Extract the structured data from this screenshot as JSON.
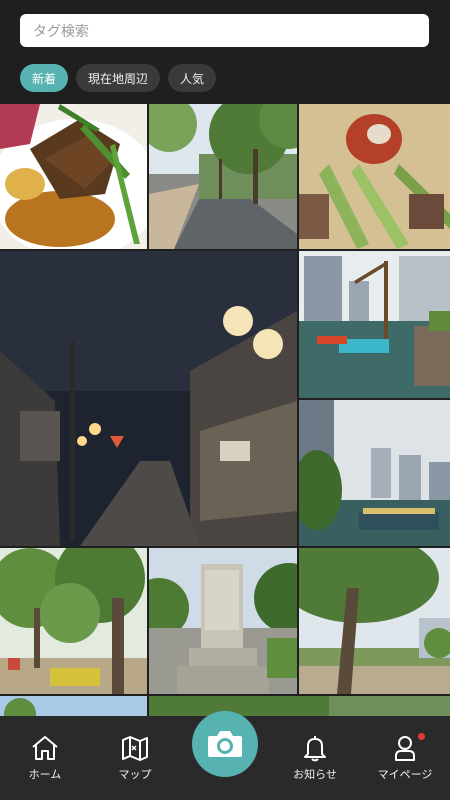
{
  "search": {
    "placeholder": "タグ検索"
  },
  "filters": [
    {
      "label": "新着",
      "active": true
    },
    {
      "label": "現在地周辺",
      "active": false
    },
    {
      "label": "人気",
      "active": false
    }
  ],
  "tabs": [
    {
      "label": "ホーム",
      "icon": "home-icon"
    },
    {
      "label": "マップ",
      "icon": "map-icon"
    },
    {
      "label": "お知らせ",
      "icon": "bell-icon"
    },
    {
      "label": "マイページ",
      "icon": "user-icon"
    }
  ],
  "camera_button": {
    "icon": "camera-icon"
  },
  "notification_dot_color": "#e53935",
  "accent": "#57b2b2",
  "photos": [
    {
      "subject": "food-dish"
    },
    {
      "subject": "park-path"
    },
    {
      "subject": "noodles-dish"
    },
    {
      "subject": "night-street"
    },
    {
      "subject": "harbor-crane"
    },
    {
      "subject": "river-towers"
    },
    {
      "subject": "trees-park"
    },
    {
      "subject": "stone-monument"
    },
    {
      "subject": "big-tree-park"
    }
  ]
}
